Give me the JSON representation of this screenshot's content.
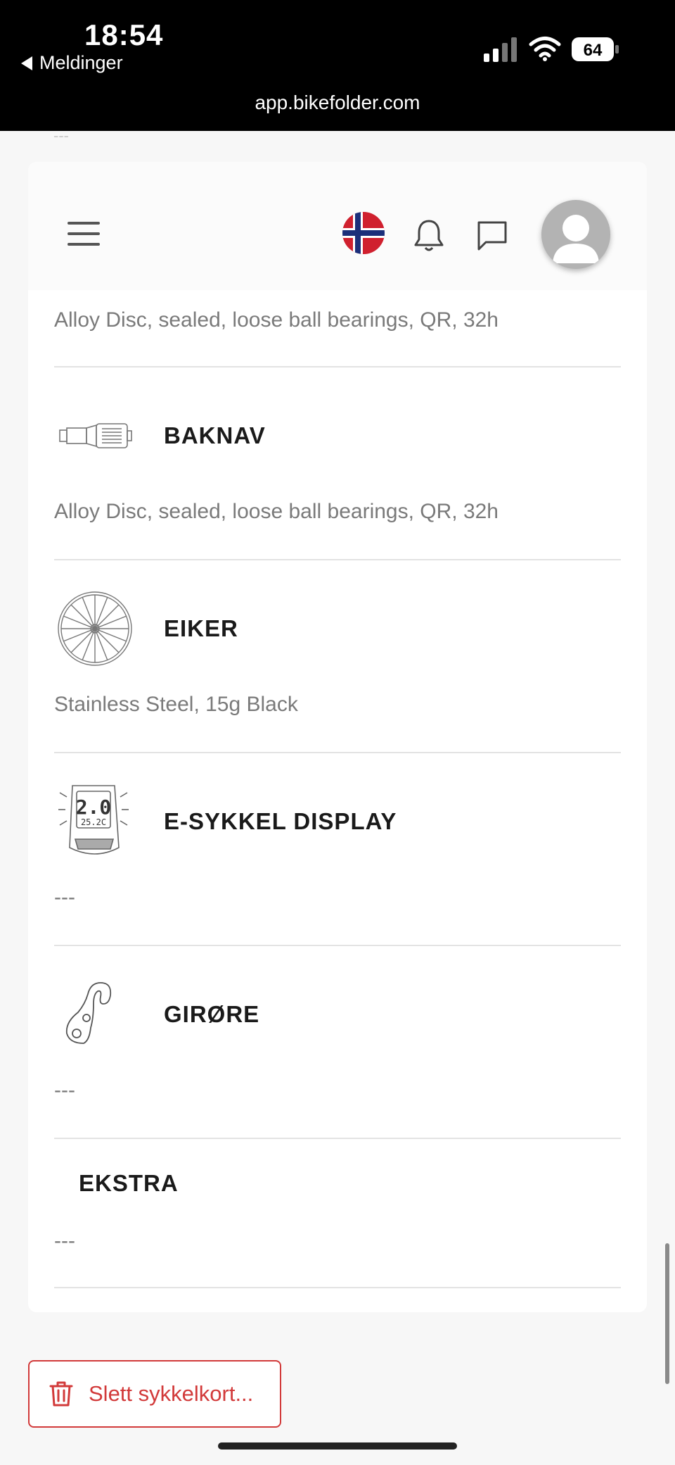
{
  "status_bar": {
    "time": "18:54",
    "back_label": "Meldinger",
    "battery": "64",
    "url": "app.bikefolder.com"
  },
  "header": {
    "menu_icon": "hamburger-icon",
    "language_icon": "norway-flag-icon",
    "notifications_icon": "bell-icon",
    "messages_icon": "chat-icon",
    "profile_icon": "avatar-icon"
  },
  "partial_top": {
    "peek_text": "---",
    "value": "Alloy Disc, sealed, loose ball bearings, QR, 32h"
  },
  "sections": [
    {
      "title": "BAKNAV",
      "value": "Alloy Disc, sealed, loose ball bearings, QR, 32h",
      "icon": "rear-hub-icon"
    },
    {
      "title": "EIKER",
      "value": "Stainless Steel, 15g Black",
      "icon": "spoked-wheel-icon"
    },
    {
      "title": "E-SYKKEL DISPLAY",
      "value": "---",
      "icon": "ebike-display-icon",
      "display_big": "2.0",
      "display_small": "25.2C"
    },
    {
      "title": "GIRØRE",
      "value": "---",
      "icon": "derailleur-hanger-icon"
    },
    {
      "title": "EKSTRA",
      "value": "---"
    }
  ],
  "footer": {
    "delete_label": "Slett sykkelkort...",
    "delete_icon": "trash-icon"
  },
  "colors": {
    "accent_red": "#d23a3a",
    "text_dark": "#1a1a1a",
    "text_muted": "#7a7a7a"
  }
}
